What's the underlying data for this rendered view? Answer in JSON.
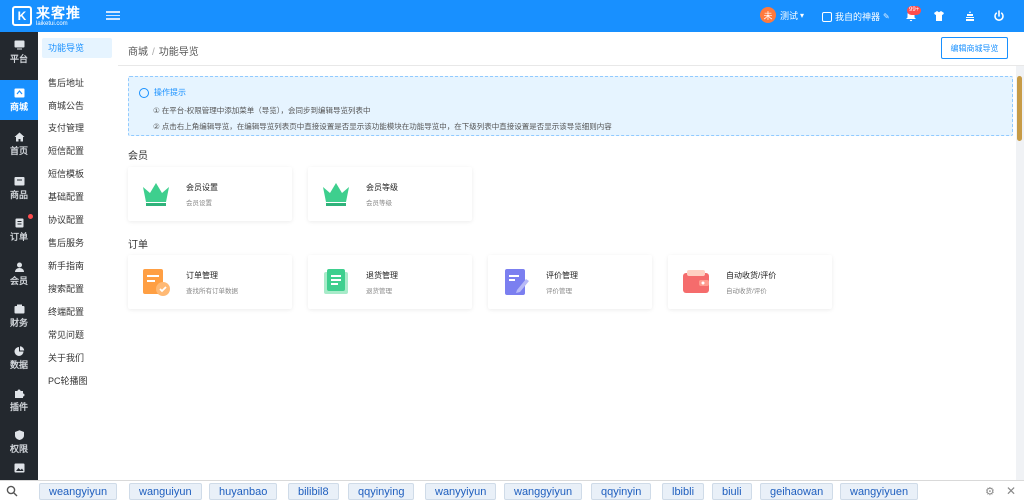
{
  "brand": {
    "logo_glyph": "K",
    "name": "来客推",
    "domain": "laiketui.com"
  },
  "topbar": {
    "user_avatar": "未",
    "user_name": "测试",
    "shop_name": "我自的神器",
    "notification_badge": "99+"
  },
  "sidenav": {
    "items": [
      {
        "label": "平台",
        "icon": "platform-icon"
      },
      {
        "label": "商城",
        "icon": "mall-icon",
        "active": true
      },
      {
        "label": "首页",
        "icon": "home-icon"
      },
      {
        "label": "商品",
        "icon": "goods-icon"
      },
      {
        "label": "订单",
        "icon": "order-icon",
        "dot": true
      },
      {
        "label": "会员",
        "icon": "member-icon"
      },
      {
        "label": "财务",
        "icon": "finance-icon"
      },
      {
        "label": "数据",
        "icon": "data-icon"
      },
      {
        "label": "插件",
        "icon": "plugin-icon"
      },
      {
        "label": "权限",
        "icon": "permission-icon"
      }
    ]
  },
  "subnav": {
    "items": [
      "功能导览",
      "售后地址",
      "商城公告",
      "支付管理",
      "短信配置",
      "短信模板",
      "基础配置",
      "协议配置",
      "售后服务",
      "新手指南",
      "搜索配置",
      "终端配置",
      "常见问题",
      "关于我们",
      "PC轮播图"
    ],
    "active_index": 0
  },
  "breadcrumb": {
    "parent": "商城",
    "separator": "/",
    "current": "功能导览"
  },
  "actions": {
    "edit_nav_label": "编辑商城导览"
  },
  "tip": {
    "title": "操作提示",
    "lines": [
      "① 在平台-权限管理中添加菜单（导览），会同步到编辑导览列表中",
      "② 点击右上角编辑导览，在编辑导览列表页中直接设置是否显示该功能模块在功能导览中，在下级列表中直接设置是否显示该导览细则内容"
    ]
  },
  "sections": [
    {
      "title": "会员",
      "cards": [
        {
          "title": "会员设置",
          "desc": "会员设置",
          "icon": "crown-icon"
        },
        {
          "title": "会员等级",
          "desc": "会员等级",
          "icon": "crown-icon"
        }
      ]
    },
    {
      "title": "订单",
      "cards": [
        {
          "title": "订单管理",
          "desc": "查找所有订单数据",
          "icon": "order-list-icon"
        },
        {
          "title": "退货管理",
          "desc": "退货管理",
          "icon": "return-list-icon"
        },
        {
          "title": "评价管理",
          "desc": "评价管理",
          "icon": "review-icon"
        },
        {
          "title": "自动收货/评价",
          "desc": "自动收货/评价",
          "icon": "wallet-icon"
        }
      ]
    }
  ],
  "bottom_tags": [
    "weangyiyun",
    "wanguiyun",
    "huyanbao",
    "bilibil8",
    "qqyinying",
    "wanyyiyun",
    "wanggyiyun",
    "qqyinyin",
    "lbibli",
    "biuli",
    "geihaowan",
    "wangyiyuen"
  ],
  "colors": {
    "primary": "#1890ff",
    "sidebar": "#23282e",
    "crown": "#3ecf8e"
  }
}
